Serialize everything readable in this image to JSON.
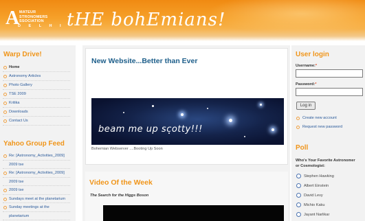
{
  "header": {
    "logo_letter": "A",
    "logo_lines": [
      "MATEUR",
      "STRONOMERS",
      "SSOCIATION"
    ],
    "logo_city": "D E L H I",
    "site_name": "tHE bohEmians!"
  },
  "left": {
    "warp_title": "Warp Drive!",
    "nav": [
      "Home",
      "Astronomy Articles",
      "Photo Gallery",
      "TSE 2009",
      "Kritika",
      "Downloads",
      "Contact Us"
    ],
    "feed_title": "Yahoo Group Feed",
    "feed": [
      "Re: [Astronomy_Activities_2009]",
      "2009 tse",
      "Re: [Astronomy_Activities_2009]",
      "2009 tse",
      "2009 tse",
      "Sundays meet at the planetarium",
      "Sunday meetings at the",
      "planetarium"
    ]
  },
  "main": {
    "post1_title": "New Website...Better than Ever",
    "hero_caption": "beam me up scotty!!!",
    "post1_caption": "Bohemian Webserver ....Booting Up Soon",
    "post2_title": "Video Of the Week",
    "post2_subtitle": "The Search for the Higgs Boson"
  },
  "right": {
    "login_title": "User login",
    "username_label": "Username:",
    "password_label": "Password:",
    "required_mark": "*",
    "login_button": "Log in",
    "links": [
      "Create new account",
      "Request new password"
    ],
    "poll_title": "Poll",
    "poll_question_1": "Who's Your Favorite Astronomer",
    "poll_question_2": "or Cosmologist:",
    "poll_options": [
      "Stephen Hawking",
      "Albert Einstein",
      "David Levy",
      "Michio Kaku",
      "Jayant Narlikar"
    ]
  }
}
